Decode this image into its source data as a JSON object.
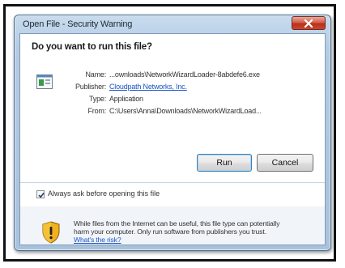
{
  "dialog": {
    "title": "Open File - Security Warning",
    "prompt": "Do you want to run this file?"
  },
  "file": {
    "name_label": "Name:",
    "name_value": "...ownloads\\NetworkWizardLoader-8abdefe6.exe",
    "publisher_label": "Publisher:",
    "publisher_value": "Cloudpath Networks, Inc.",
    "type_label": "Type:",
    "type_value": "Application",
    "from_label": "From:",
    "from_value": "C:\\Users\\Anna\\Downloads\\NetworkWizardLoad..."
  },
  "buttons": {
    "run_label": "Run",
    "cancel_label": "Cancel"
  },
  "checkbox": {
    "label": "Always ask before opening this file",
    "checked": true
  },
  "warning": {
    "text": "While files from the Internet can be useful, this file type can potentially harm your computer. Only run software from publishers you trust.",
    "link": "What's the risk?"
  },
  "colors": {
    "link": "#1b55c4",
    "close_button": "#c9472f",
    "title_bar": "#b3cbe3"
  },
  "icons": [
    "application-icon",
    "close-icon",
    "checkmark-icon",
    "shield-warning-icon"
  ]
}
